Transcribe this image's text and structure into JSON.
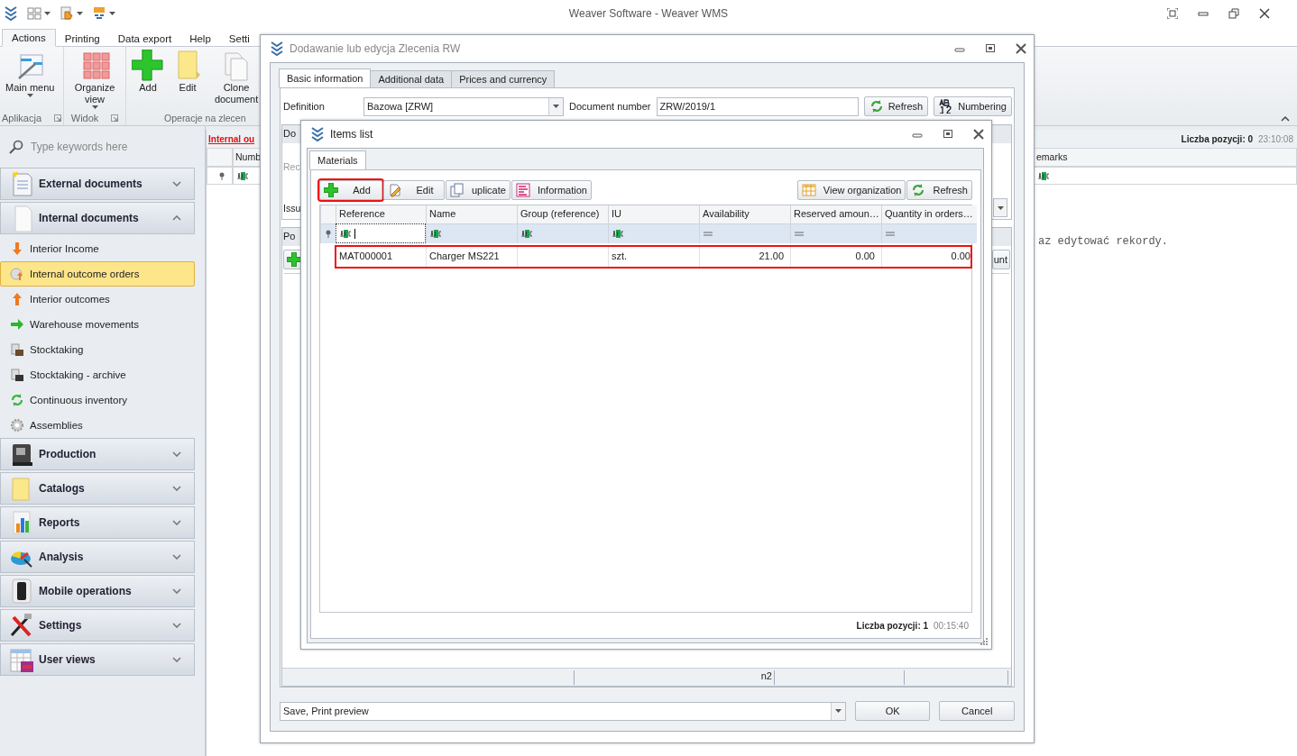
{
  "app": {
    "title": "Weaver Software - Weaver WMS"
  },
  "ribbon": {
    "tabs": [
      {
        "label": "Actions",
        "selected": true
      },
      {
        "label": "Printing",
        "selected": false
      },
      {
        "label": "Data export",
        "selected": false
      },
      {
        "label": "Help",
        "selected": false
      },
      {
        "label": "Setti",
        "selected": false
      }
    ],
    "groups": [
      {
        "label": "Aplikacja",
        "launcher": true,
        "buttons": [
          {
            "label": "Main menu",
            "dropdown": true
          }
        ]
      },
      {
        "label": "Widok",
        "launcher": true,
        "buttons": [
          {
            "label": "Organize view",
            "dropdown": true
          }
        ]
      },
      {
        "label": "Operacje na zlecen",
        "launcher": false,
        "buttons": [
          {
            "label": "Add",
            "dropdown": false
          },
          {
            "label": "Edit",
            "dropdown": false
          },
          {
            "label": "Clone document",
            "dropdown": false
          }
        ]
      }
    ]
  },
  "sidebar": {
    "search_placeholder": "Type keywords here",
    "sections": [
      {
        "label": "External documents",
        "expanded": false
      },
      {
        "label": "Internal documents",
        "expanded": true,
        "items": [
          {
            "label": "Interior Income",
            "selected": false
          },
          {
            "label": "Internal outcome orders",
            "selected": true
          },
          {
            "label": "Interior outcomes",
            "selected": false
          },
          {
            "label": "Warehouse movements",
            "selected": false
          },
          {
            "label": "Stocktaking",
            "selected": false
          },
          {
            "label": "Stocktaking - archive",
            "selected": false
          },
          {
            "label": "Continuous inventory",
            "selected": false
          },
          {
            "label": "Assemblies",
            "selected": false
          }
        ]
      },
      {
        "label": "Production",
        "expanded": false
      },
      {
        "label": "Catalogs",
        "expanded": false
      },
      {
        "label": "Reports",
        "expanded": false
      },
      {
        "label": "Analysis",
        "expanded": false
      },
      {
        "label": "Mobile operations",
        "expanded": false
      },
      {
        "label": "Settings",
        "expanded": false
      },
      {
        "label": "User views",
        "expanded": false
      }
    ]
  },
  "main": {
    "title": "Internal ou",
    "count": "Liczba pozycji: 0",
    "time": "23:10:08",
    "columns": [
      "Numb",
      "emarks"
    ],
    "message": "az edytować rekordy."
  },
  "order_dialog": {
    "title": "Dodawanie lub edycja Zlecenia RW",
    "tabs": [
      {
        "label": "Basic information",
        "selected": true
      },
      {
        "label": "Additional data",
        "selected": false
      },
      {
        "label": "Prices and currency",
        "selected": false
      }
    ],
    "definition_label": "Definition",
    "definition_value": "Bazowa [ZRW]",
    "number_label": "Document number",
    "number_value": "ZRW/2019/1",
    "buttons": [
      "Refresh",
      "Numbering"
    ],
    "group_1": {
      "header": "Do",
      "line_1": "Rec",
      "line_2": "Issu"
    },
    "group_2": {
      "header": "Po",
      "button_right": "unt",
      "status": "n2"
    },
    "action_value": "Save, Print preview",
    "ok": "OK",
    "cancel": "Cancel"
  },
  "items_dialog": {
    "title": "Items list",
    "tabs": [
      {
        "label": "Materials",
        "selected": true
      }
    ],
    "toolbar": [
      {
        "label": "Add",
        "highlighted": true
      },
      {
        "label": "Edit",
        "highlighted": false
      },
      {
        "label": "uplicate",
        "highlighted": false
      },
      {
        "label": "Information",
        "highlighted": false
      }
    ],
    "toolbar_right": [
      "View organization",
      "Refresh"
    ],
    "columns": [
      {
        "label": "Reference",
        "kind": "text"
      },
      {
        "label": "Name",
        "kind": "text"
      },
      {
        "label": "Group (reference)",
        "kind": "text"
      },
      {
        "label": "IU",
        "kind": "text"
      },
      {
        "label": "Availability",
        "kind": "number"
      },
      {
        "label": "Reserved amoun…",
        "kind": "number"
      },
      {
        "label": "Quantity in orders…",
        "kind": "number"
      }
    ],
    "rows": [
      {
        "highlighted": true,
        "cells": [
          "MAT000001",
          "Charger MS221",
          "",
          "szt.",
          "21.00",
          "0.00",
          "0.00"
        ]
      }
    ],
    "count": "Liczba pozycji: 1",
    "time": "00:15:40"
  }
}
